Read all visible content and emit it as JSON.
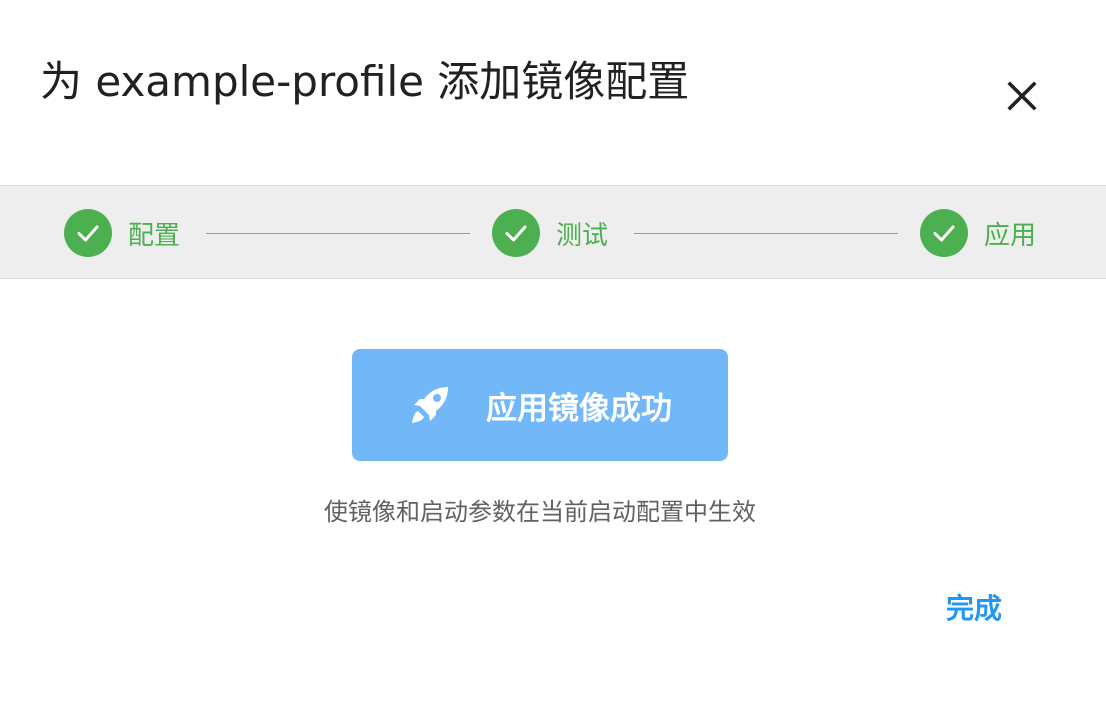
{
  "dialog": {
    "title": "为 example-profile 添加镜像配置",
    "close_icon": "close-icon"
  },
  "stepper": {
    "steps": [
      {
        "label": "配置",
        "status": "complete",
        "icon": "check-icon"
      },
      {
        "label": "测试",
        "status": "complete",
        "icon": "check-icon"
      },
      {
        "label": "应用",
        "status": "complete",
        "icon": "check-icon"
      }
    ],
    "complete_color": "#4caf50"
  },
  "result": {
    "icon": "rocket-icon",
    "text": "应用镜像成功",
    "card_color": "#72b8f8"
  },
  "hint": "使镜像和启动参数在当前启动配置中生效",
  "actions": {
    "finish_label": "完成",
    "finish_color": "#2196f3"
  }
}
